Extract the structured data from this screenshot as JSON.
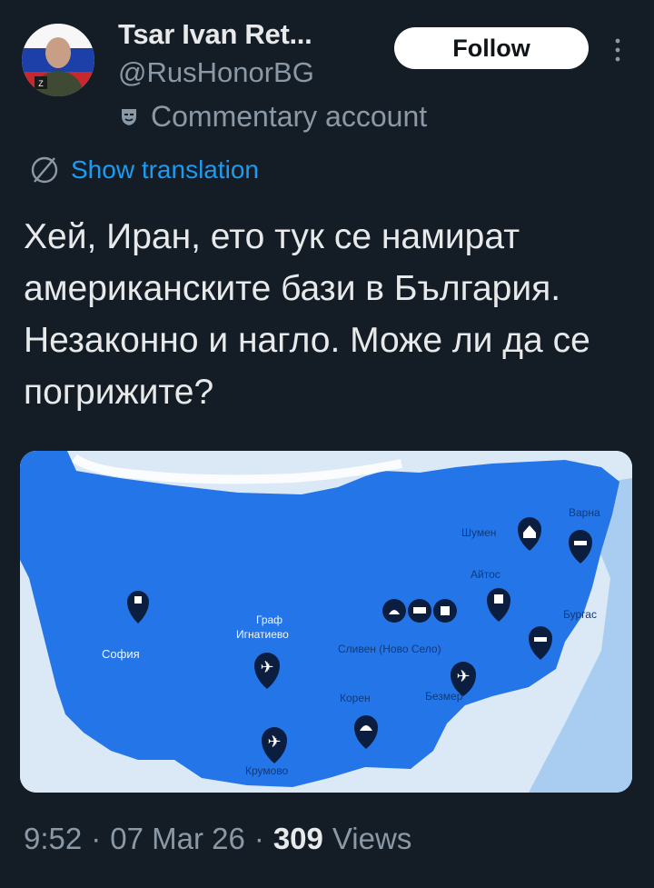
{
  "user": {
    "display_name": "Tsar Ivan Ret...",
    "handle": "@RusHonorBG",
    "label": "Commentary account"
  },
  "actions": {
    "follow_label": "Follow",
    "more_icon": "more-vertical-icon"
  },
  "translation": {
    "label": "Show translation",
    "icon": "translate-icon"
  },
  "tweet": {
    "text": "Хей, Иран, ето тук се намират американските бази в България. Незаконно и нагло. Може ли да се погрижите?"
  },
  "map": {
    "labels": {
      "varna": "Варна",
      "shumen": "Шумен",
      "aitos": "Айтос",
      "burgas": "Бургас",
      "sofia": "София",
      "graf_line1": "Граф",
      "graf_line2": "Игнатиево",
      "sliven": "Сливен (Ново Село)",
      "koren": "Корен",
      "bezmer": "Безмер",
      "krumovo": "Крумово"
    },
    "colors": {
      "land": "#2476e8",
      "sea": "#dbe8f5",
      "pin": "#0b1e40"
    }
  },
  "meta": {
    "time": "9:52",
    "date": "07 Mar 26",
    "views_count": "309",
    "views_label": "Views",
    "sep": "·"
  }
}
